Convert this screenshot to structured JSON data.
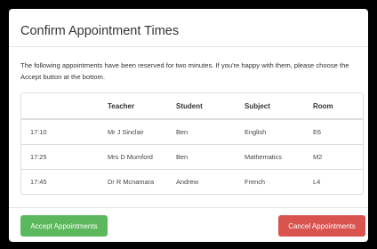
{
  "modal": {
    "title": "Confirm Appointment Times",
    "intro": "The following appointments have been reserved for two minutes. If you're happy with them, please choose the Accept button at the bottom."
  },
  "table": {
    "headers": [
      "",
      "Teacher",
      "Student",
      "Subject",
      "Room"
    ],
    "rows": [
      {
        "time": "17:10",
        "teacher": "Mr J Sinclair",
        "student": "Ben",
        "subject": "English",
        "room": "E6"
      },
      {
        "time": "17:25",
        "teacher": "Mrs D Mumford",
        "student": "Ben",
        "subject": "Mathematics",
        "room": "M2"
      },
      {
        "time": "17:45",
        "teacher": "Dr R Mcnamara",
        "student": "Andrew",
        "subject": "French",
        "room": "L4"
      }
    ]
  },
  "footer": {
    "accept_label": "Accept Appointments",
    "cancel_label": "Cancel Appointments"
  },
  "colors": {
    "accept": "#5cb85c",
    "cancel": "#d9534f",
    "backdrop": "#000000"
  }
}
